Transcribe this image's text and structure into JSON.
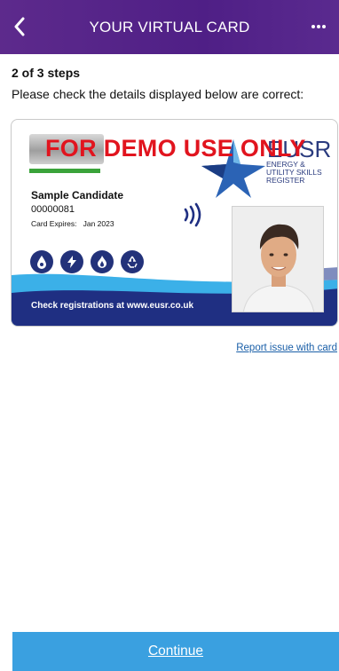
{
  "header": {
    "title": "YOUR VIRTUAL CARD",
    "back_icon": "chevron-left-icon",
    "more_icon": "more-horizontal-icon",
    "background_color": "#4f1f86"
  },
  "steps": {
    "label": "2 of 3 steps",
    "instruction": "Please check the details displayed below are correct:"
  },
  "card": {
    "watermark": "FOR DEMO USE ONLY",
    "brand": "EUSR",
    "brand_sub": [
      "ENERGY &",
      "UTILITY SKILLS",
      "REGISTER"
    ],
    "holder_name": "Sample Candidate",
    "card_number": "00000081",
    "expires_label": "Card Expires:",
    "expires_value": "Jan 2023",
    "footer": "Check registrations at www.eusr.co.uk",
    "icons": [
      "water-drop-icon",
      "electricity-icon",
      "gas-flame-icon",
      "recycle-icon"
    ],
    "accent_color": "#23327a",
    "watermark_color": "#e1141e"
  },
  "actions": {
    "report_link": "Report issue with card",
    "continue_label": "Continue",
    "continue_color": "#3aa0e0"
  }
}
